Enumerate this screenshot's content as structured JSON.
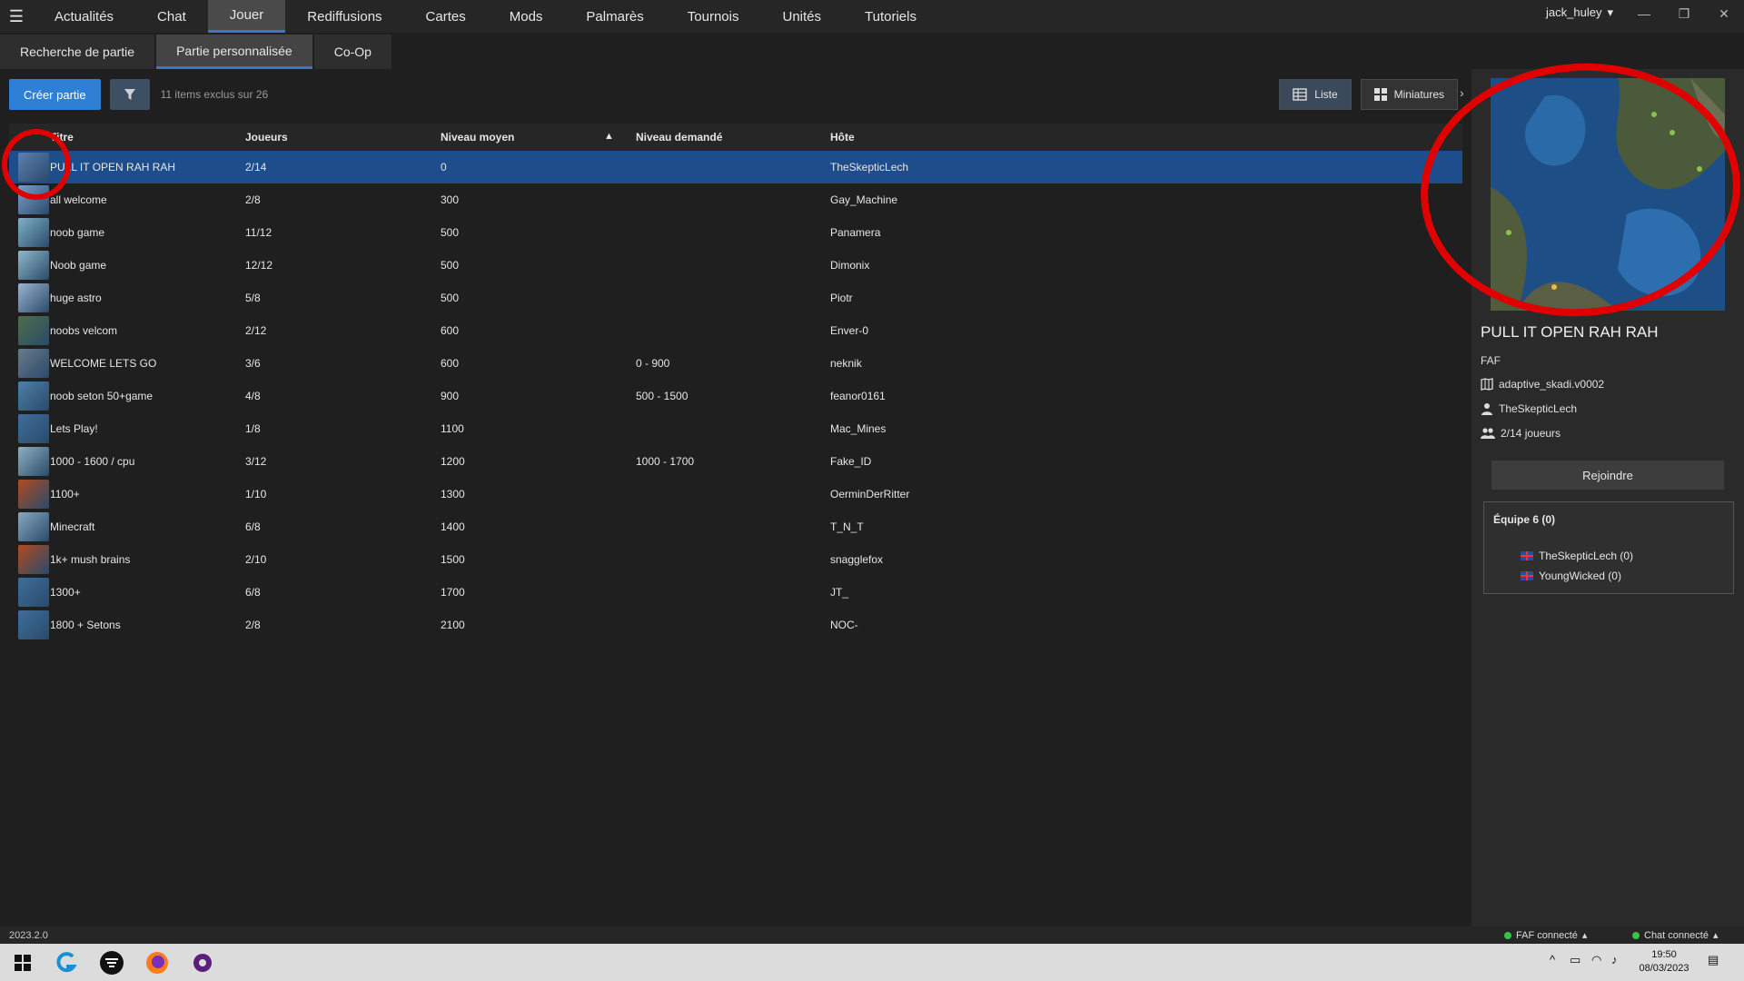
{
  "nav": {
    "tabs": [
      "Actualités",
      "Chat",
      "Jouer",
      "Rediffusions",
      "Cartes",
      "Mods",
      "Palmarès",
      "Tournois",
      "Unités",
      "Tutoriels"
    ],
    "active": "Jouer",
    "username": "jack_huley"
  },
  "subtabs": [
    "Recherche de partie",
    "Partie personnalisée",
    "Co-Op"
  ],
  "toolbar": {
    "create_label": "Créer partie",
    "excluded_text": "11 items exclus sur 26",
    "list_label": "Liste",
    "thumbs_label": "Miniatures"
  },
  "table": {
    "headers": {
      "title": "Titre",
      "players": "Joueurs",
      "avg": "Niveau moyen",
      "req": "Niveau demandé",
      "host": "Hôte"
    },
    "rows": [
      {
        "title": "PULL IT OPEN RAH RAH",
        "players": "2/14",
        "avg": "0",
        "req": "",
        "host": "TheSkepticLech"
      },
      {
        "title": "all welcome",
        "players": "2/8",
        "avg": "300",
        "req": "",
        "host": "Gay_Machine"
      },
      {
        "title": "noob game",
        "players": "11/12",
        "avg": "500",
        "req": "",
        "host": "Panamera"
      },
      {
        "title": "Noob game",
        "players": "12/12",
        "avg": "500",
        "req": "",
        "host": "Dimonix"
      },
      {
        "title": "huge astro",
        "players": "5/8",
        "avg": "500",
        "req": "",
        "host": "Piotr"
      },
      {
        "title": "noobs velcom",
        "players": "2/12",
        "avg": "600",
        "req": "",
        "host": "Enver-0"
      },
      {
        "title": "WELCOME LETS GO",
        "players": "3/6",
        "avg": "600",
        "req": "0 - 900",
        "host": "neknik"
      },
      {
        "title": "noob seton 50+game",
        "players": "4/8",
        "avg": "900",
        "req": "500 - 1500",
        "host": "feanor0161"
      },
      {
        "title": "Lets Play!",
        "players": "1/8",
        "avg": "1100",
        "req": "",
        "host": "Mac_Mines"
      },
      {
        "title": "1000 - 1600 / cpu",
        "players": "3/12",
        "avg": "1200",
        "req": "1000 - 1700",
        "host": "Fake_ID"
      },
      {
        "title": "1100+",
        "players": "1/10",
        "avg": "1300",
        "req": "",
        "host": "OerminDerRitter"
      },
      {
        "title": "Minecraft",
        "players": "6/8",
        "avg": "1400",
        "req": "",
        "host": "T_N_T"
      },
      {
        "title": "1k+ mush brains",
        "players": "2/10",
        "avg": "1500",
        "req": "",
        "host": "snagglefox"
      },
      {
        "title": "1300+",
        "players": "6/8",
        "avg": "1700",
        "req": "",
        "host": "JT_"
      },
      {
        "title": "1800 + Setons",
        "players": "2/8",
        "avg": "2100",
        "req": "",
        "host": "NOC-"
      }
    ]
  },
  "details": {
    "title": "PULL IT OPEN RAH RAH",
    "mod": "FAF",
    "map": "adaptive_skadi.v0002",
    "host": "TheSkepticLech",
    "players": "2/14 joueurs",
    "join_label": "Rejoindre",
    "team_title": "Équipe 6 (0)",
    "team_players": [
      "TheSkepticLech (0)",
      "YoungWicked (0)"
    ]
  },
  "status": {
    "version": "2023.2.0",
    "faf": "FAF connecté",
    "chat": "Chat connecté"
  },
  "taskbar": {
    "time": "19:50",
    "date": "08/03/2023"
  },
  "colors": {
    "accent": "#2f7fd6",
    "selected_row": "#1e4d8c",
    "annotation_red": "#e00000"
  }
}
